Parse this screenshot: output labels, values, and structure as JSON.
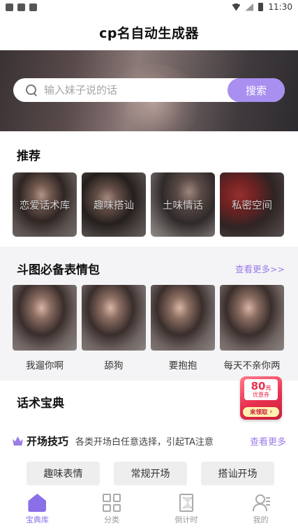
{
  "status_bar": {
    "time": "11:30"
  },
  "header": {
    "title": "cp名自动生成器"
  },
  "search": {
    "placeholder": "输入妹子说的话",
    "button_label": "搜索"
  },
  "recommend": {
    "title": "推荐",
    "items": [
      {
        "label": "恋爱话术库"
      },
      {
        "label": "趣味搭讪"
      },
      {
        "label": "土味情话"
      },
      {
        "label": "私密空间"
      }
    ]
  },
  "emoji_section": {
    "title": "斗图必备表情包",
    "more_label": "查看更多>>",
    "items": [
      {
        "label": "我遛你啊"
      },
      {
        "label": "舔狗"
      },
      {
        "label": "要抱抱"
      },
      {
        "label": "每天不亲你两"
      }
    ]
  },
  "promo": {
    "amount": "80",
    "unit": "元",
    "subtitle": "优惠券",
    "claim_label": "来领取"
  },
  "tips": {
    "title": "话术宝典",
    "row_title": "开场技巧",
    "row_desc": "各类开场白任意选择，引起TA注意",
    "more_label": "查看更多",
    "chips": [
      {
        "label": "趣味表情"
      },
      {
        "label": "常规开场"
      },
      {
        "label": "搭讪开场"
      }
    ]
  },
  "tabbar": {
    "tabs": [
      {
        "label": "宝典库",
        "icon": "home-icon",
        "active": true
      },
      {
        "label": "分类",
        "icon": "grid-icon",
        "active": false
      },
      {
        "label": "倒计时",
        "icon": "hourglass-icon",
        "active": false
      },
      {
        "label": "我的",
        "icon": "user-icon",
        "active": false
      }
    ]
  },
  "colors": {
    "accent": "#9b7ce8",
    "search_button": "#a98ff0",
    "promo_red": "#e8304f"
  }
}
